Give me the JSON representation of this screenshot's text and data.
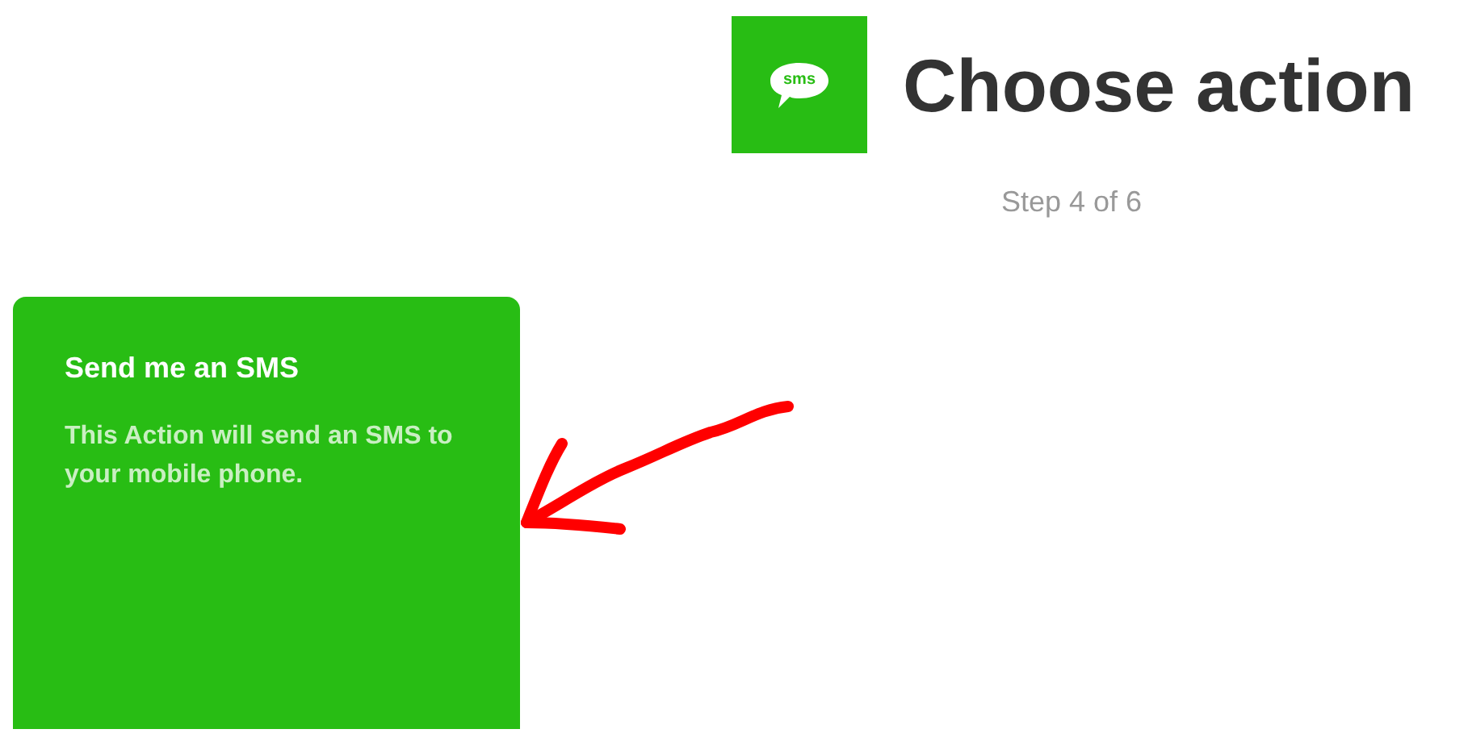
{
  "header": {
    "icon_label": "sms",
    "title": "Choose action",
    "step": "Step 4 of 6"
  },
  "actions": [
    {
      "title": "Send me an SMS",
      "description": "This Action will send an SMS to your mobile phone.",
      "color": "#28bd14"
    }
  ]
}
